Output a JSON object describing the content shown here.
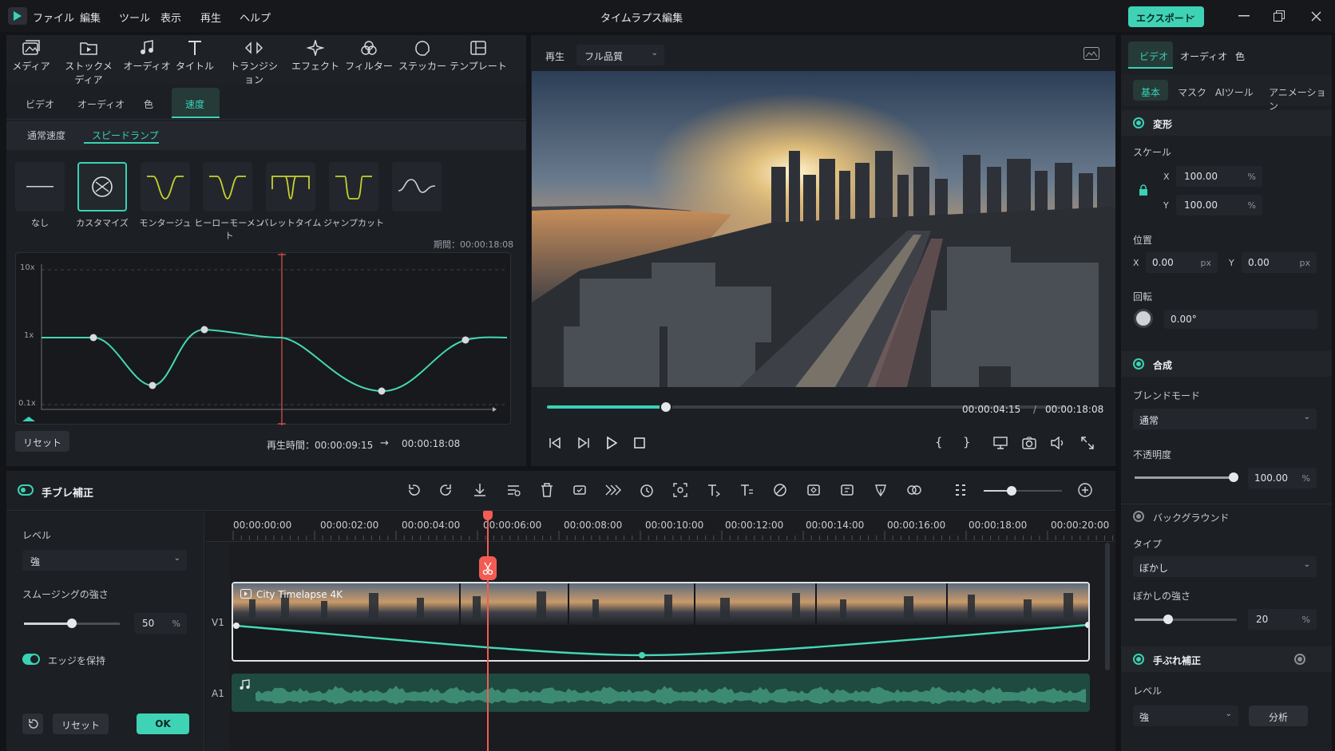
{
  "titlebar": {
    "menu": [
      "ファイル",
      "編集",
      "ツール",
      "表示",
      "再生",
      "ヘルプ"
    ],
    "title": "タイムラプス編集",
    "export_label": "エクスポート"
  },
  "toolbar": {
    "items": [
      "メディア",
      "ストックメディア",
      "オーディオ",
      "タイトル",
      "トランジション",
      "エフェクト",
      "フィルター",
      "ステッカー",
      "テンプレート"
    ]
  },
  "left_panel": {
    "tabs": [
      "ビデオ",
      "オーディオ",
      "色",
      "速度"
    ],
    "subtabs": [
      "通常速度",
      "スピードランプ"
    ],
    "presets": [
      "なし",
      "カスタマイズ",
      "モンタージュ",
      "ヒーローモーメント",
      "バレットタイム",
      "ジャンプカット"
    ],
    "duration_label": "期間：00:00:18:08",
    "graph_labels": [
      "10x",
      "1x",
      "0.1x"
    ],
    "reset_label": "リセット",
    "playtime_label": "再生時間：00:00:09:15",
    "arrow": "→",
    "playtime_target": "00:00:18:08"
  },
  "preview": {
    "play_label": "再生",
    "quality": "フル品質",
    "progress": 0.23,
    "current_time": "00:00:04:15",
    "separator": "/",
    "total_time": "00:00:18:08",
    "mark_in": "{",
    "mark_out": "}"
  },
  "right_panel": {
    "tabs": [
      "ビデオ",
      "オーディオ",
      "色"
    ],
    "subtabs": [
      "基本",
      "マスク",
      "AIツール",
      "アニメーション"
    ],
    "transform_title": "変形",
    "scale_label": "スケール",
    "scale_x_label": "X",
    "scale_x": "100.00",
    "scale_y_label": "Y",
    "scale_y": "100.00",
    "percent": "%",
    "position_label": "位置",
    "pos_x_label": "X",
    "pos_x": "0.00",
    "pos_y_label": "Y",
    "pos_y": "0.00",
    "px": "px",
    "rotation_label": "回転",
    "rotation": "0.00°",
    "composite_title": "合成",
    "blend_label": "ブレンドモード",
    "blend_value": "通常",
    "opacity_label": "不透明度",
    "opacity_value": "100.00",
    "background_title": "バックグラウンド",
    "type_label": "タイプ",
    "type_value": "ぼかし",
    "blur_label": "ぼかしの強さ",
    "blur_value": "20",
    "stabilize_title": "手ぶれ補正",
    "level_label": "レベル",
    "level_value": "強",
    "analyze_label": "分析"
  },
  "stab_panel": {
    "title": "手ブレ補正",
    "level_label": "レベル",
    "level_value": "強",
    "smoothing_label": "スムージングの強さ",
    "smoothing_value": "50",
    "percent": "%",
    "keep_edges_label": "エッジを保持",
    "reset_label": "リセット",
    "ok_label": "OK"
  },
  "timeline": {
    "ruler": [
      "00:00:00:00",
      "00:00:02:00",
      "00:00:04:00",
      "00:00:06:00",
      "00:00:08:00",
      "00:00:10:00",
      "00:00:12:00",
      "00:00:14:00",
      "00:00:16:00",
      "00:00:18:00",
      "00:00:20:00"
    ],
    "track_v1": "V1",
    "track_a1": "A1",
    "clip_title": "City Timelapse 4K"
  },
  "colors": {
    "accent": "#39d2b5",
    "playhead": "#f25c54"
  }
}
